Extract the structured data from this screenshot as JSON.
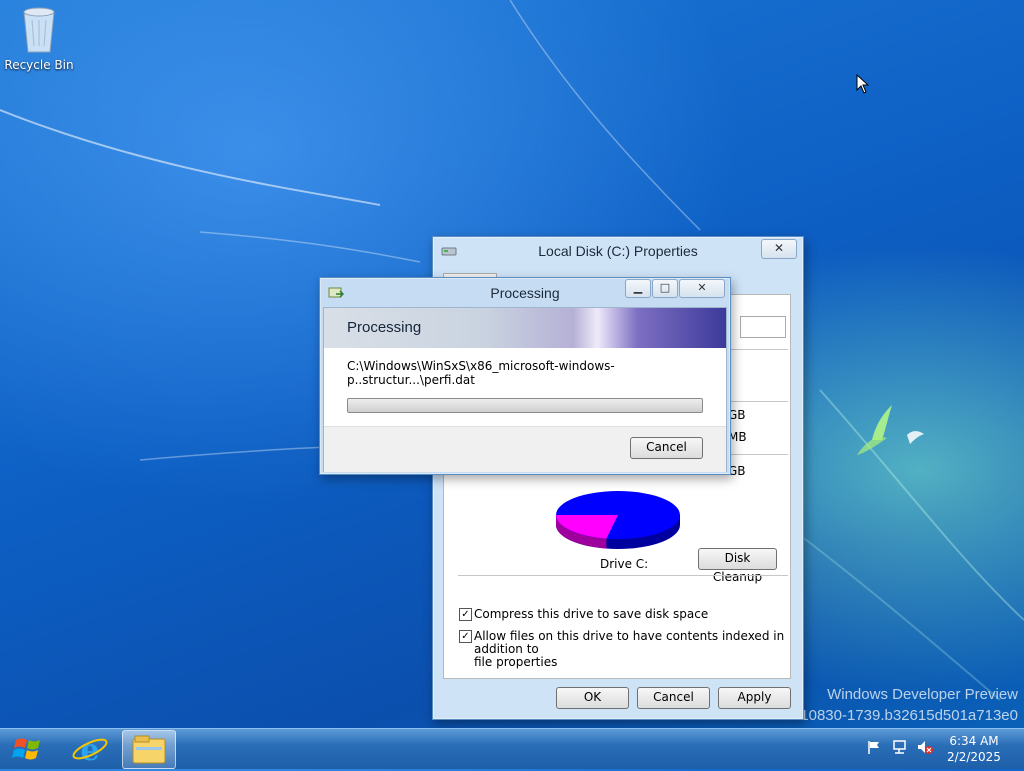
{
  "desktop": {
    "recycle_bin_label": "Recycle Bin",
    "watermark_line1": "Windows Developer Preview",
    "watermark_line2": "10830-1739.b32615d501a713e0"
  },
  "properties_window": {
    "title": "Local Disk (C:) Properties",
    "close_glyph": "✕",
    "size_gb_1": "GB",
    "size_mb": "MB",
    "size_gb_2": "GB",
    "drive_label": "Drive C:",
    "disk_cleanup_label": "Disk Cleanup",
    "compress_label": "Compress this drive to save disk space",
    "compress_checked": true,
    "index_label_line1": "Allow files on this drive to have contents indexed in addition to",
    "index_label_line2": "file properties",
    "index_checked": true,
    "ok_label": "OK",
    "cancel_label": "Cancel",
    "apply_label": "Apply",
    "used_color": "#ff00ff",
    "free_color": "#0000ff",
    "used_fraction": 0.22
  },
  "processing_dialog": {
    "title": "Processing",
    "minimize_glyph": "▁",
    "maximize_glyph": "□",
    "close_glyph": "✕",
    "heading": "Processing",
    "current_file": "C:\\Windows\\WinSxS\\x86_microsoft-windows-p..structur...\\perfi.dat",
    "progress_fraction": 0,
    "cancel_label": "Cancel"
  },
  "taskbar": {
    "time": "6:34 AM",
    "date": "2/2/2025"
  }
}
